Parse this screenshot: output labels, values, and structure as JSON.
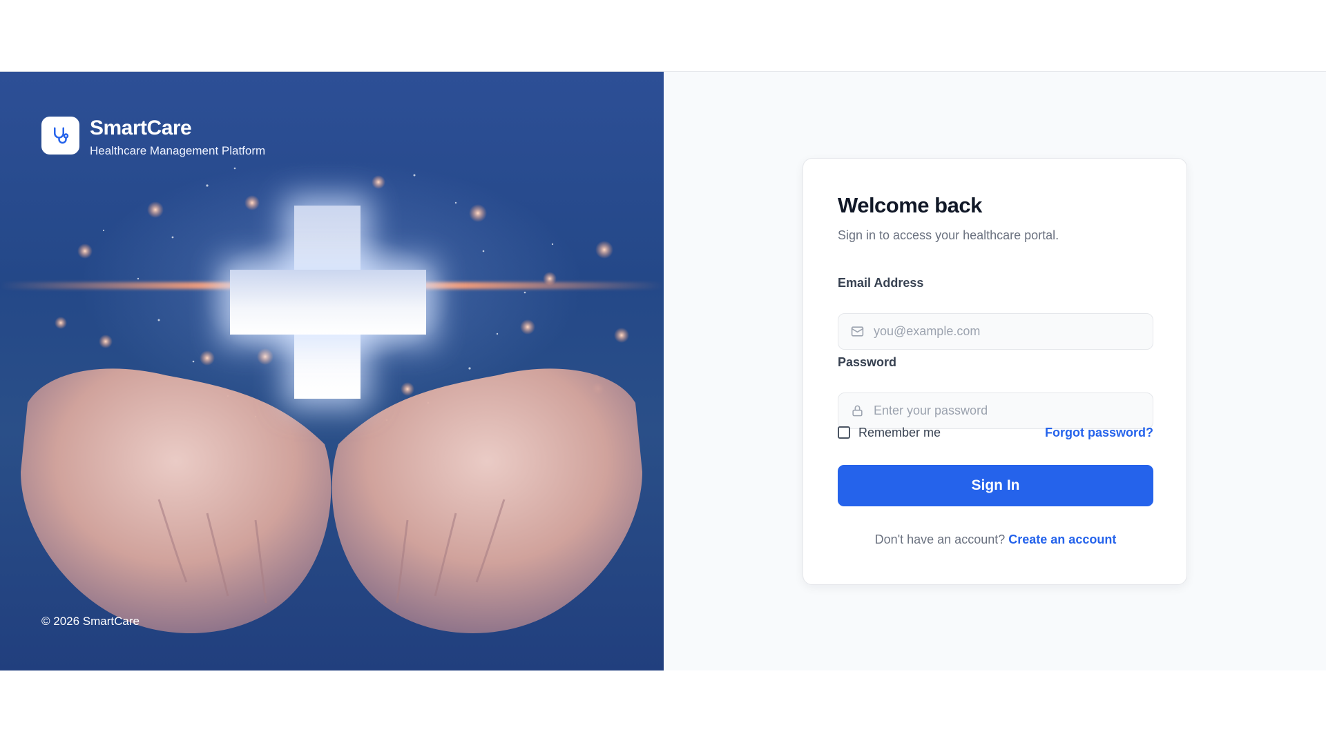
{
  "brand": {
    "name": "SmartCare",
    "tagline": "Healthcare Management Platform",
    "logo_icon": "stethoscope-icon",
    "copyright": "© 2026 SmartCare"
  },
  "login": {
    "title": "Welcome back",
    "subtitle": "Sign in to access your healthcare portal.",
    "email_label": "Email Address",
    "email_placeholder": "you@example.com",
    "email_value": "",
    "email_icon": "mail-icon",
    "password_label": "Password",
    "password_placeholder": "Enter your password",
    "password_value": "",
    "password_icon": "lock-icon",
    "remember_label": "Remember me",
    "remember_checked": false,
    "forgot_label": "Forgot password?",
    "submit_label": "Sign In",
    "signup_prompt": "Don't have an account?",
    "signup_link": "Create an account"
  },
  "colors": {
    "primary": "#2563eb",
    "heading": "#111827",
    "muted": "#6b7280",
    "panel_bg": "#f8fafc",
    "hero_blue": "#2a4f8f"
  }
}
